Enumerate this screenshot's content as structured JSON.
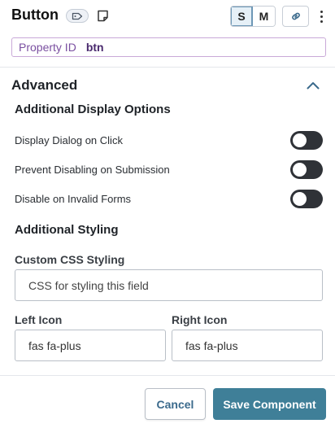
{
  "header": {
    "title": "Button",
    "size_options": [
      {
        "label": "S",
        "active": true
      },
      {
        "label": "M",
        "active": false
      }
    ],
    "icons": [
      "tag-icon",
      "note-icon",
      "link-icon",
      "more-vertical-icon"
    ]
  },
  "property": {
    "label": "Property ID",
    "value": "btn"
  },
  "advanced": {
    "title": "Advanced",
    "expanded": true,
    "display_options": {
      "title": "Additional Display Options",
      "items": [
        {
          "label": "Display Dialog on Click",
          "enabled": false
        },
        {
          "label": "Prevent Disabling on Submission",
          "enabled": false
        },
        {
          "label": "Disable on Invalid Forms",
          "enabled": false
        }
      ]
    },
    "styling": {
      "title": "Additional Styling",
      "custom_css": {
        "label": "Custom CSS Styling",
        "placeholder": "CSS for styling this field",
        "value": ""
      },
      "left_icon": {
        "label": "Left Icon",
        "value": "fas fa-plus"
      },
      "right_icon": {
        "label": "Right Icon",
        "value": "fas fa-plus"
      }
    }
  },
  "footer": {
    "cancel_label": "Cancel",
    "save_label": "Save Component"
  },
  "colors": {
    "primary": "#3f7f98",
    "toggle_off": "#2f3237",
    "property_accent": "#7a4fa0"
  }
}
